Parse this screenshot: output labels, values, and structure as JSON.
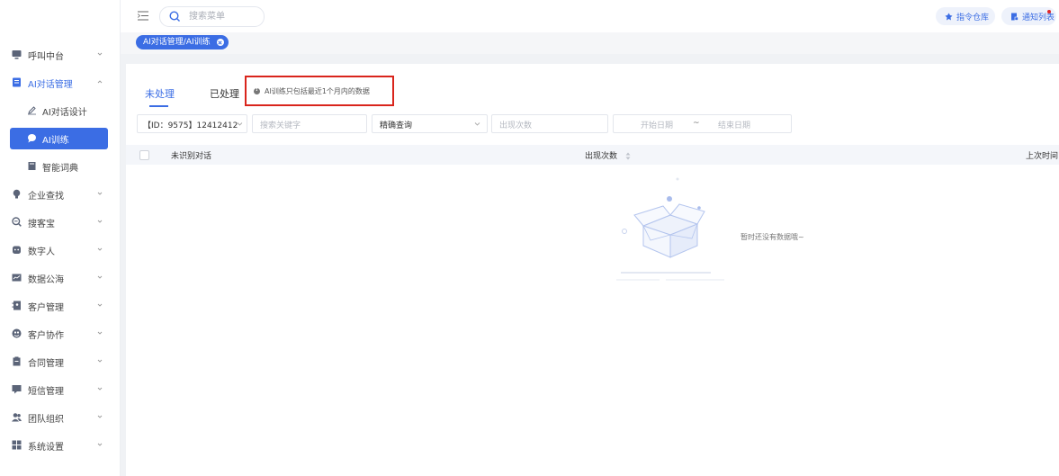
{
  "sidebar": {
    "items": [
      {
        "label": "呼叫中台",
        "icon": "monitor-icon"
      },
      {
        "label": "AI对话管理",
        "icon": "document-icon"
      },
      {
        "label": "AI对话设计",
        "icon": "pen-icon"
      },
      {
        "label": "AI训练",
        "icon": "chat-bubble-icon"
      },
      {
        "label": "智能词典",
        "icon": "book-icon"
      },
      {
        "label": "企业查找",
        "icon": "lightbulb-icon"
      },
      {
        "label": "搜客宝",
        "icon": "search-plus-icon"
      },
      {
        "label": "数字人",
        "icon": "robot-icon"
      },
      {
        "label": "数据公海",
        "icon": "chart-panel-icon"
      },
      {
        "label": "客户管理",
        "icon": "contact-book-icon"
      },
      {
        "label": "客户协作",
        "icon": "cooperation-icon"
      },
      {
        "label": "合同管理",
        "icon": "clipboard-icon"
      },
      {
        "label": "短信管理",
        "icon": "message-icon"
      },
      {
        "label": "团队组织",
        "icon": "team-icon"
      },
      {
        "label": "系统设置",
        "icon": "settings-grid-icon"
      }
    ]
  },
  "header": {
    "search_placeholder": "搜索菜单",
    "command_warehouse_label": "指令仓库",
    "notifications_label": "通知列表"
  },
  "tagbar": {
    "active_tag": "AI对话管理/AI训练"
  },
  "main": {
    "tabs": [
      "未处理",
      "已处理"
    ],
    "active_tab": "未处理",
    "notice": "AI训练只包括最近1个月内的数据",
    "filters": {
      "account_select": "【ID：9575】12412412",
      "keyword_placeholder": "搜索关键字",
      "match_mode": "精确查询",
      "count_placeholder": "出现次数",
      "start_date_placeholder": "开始日期",
      "date_separator": "~",
      "end_date_placeholder": "结束日期"
    },
    "table": {
      "columns": [
        "未识别对话",
        "出现次数",
        "上次时间"
      ]
    },
    "empty_text": "暂时还没有数据哦~"
  },
  "colors": {
    "accent": "#3b6de4",
    "highlight_border": "#d9251c",
    "notify_dot": "#e0262a"
  }
}
